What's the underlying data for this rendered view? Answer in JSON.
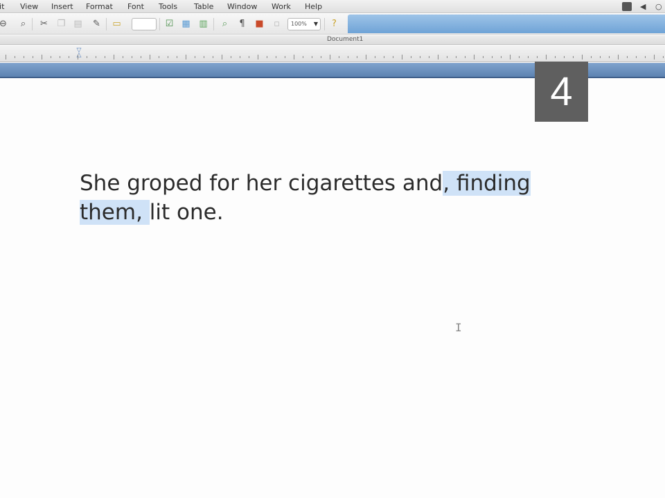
{
  "menubar": {
    "items": [
      "lit",
      "View",
      "Insert",
      "Format",
      "Font",
      "Tools",
      "Table",
      "Window",
      "Work",
      "Help"
    ]
  },
  "toolbar": {
    "font_combo": "",
    "zoom_value": "100%",
    "icons": [
      "zoom-out-icon",
      "search-icon",
      "cut-icon",
      "copy-icon",
      "paste-icon",
      "format-brush-icon",
      "style-icon",
      "edit-icon",
      "table-icon",
      "columns-icon",
      "find-icon",
      "pilcrow-icon",
      "toolbox-icon",
      "grid-icon",
      "help-icon"
    ]
  },
  "document": {
    "title": "Document1",
    "line1_plain": "She groped for her cigarettes and",
    "line1_highlight": ", finding",
    "line2_highlight": "them, ",
    "line2_plain": "lit one."
  },
  "overlay": {
    "step_number": "4"
  },
  "colors": {
    "highlight": "#cfe2f7",
    "band": "#6a8fbe",
    "badge": "#5f5f5f"
  }
}
